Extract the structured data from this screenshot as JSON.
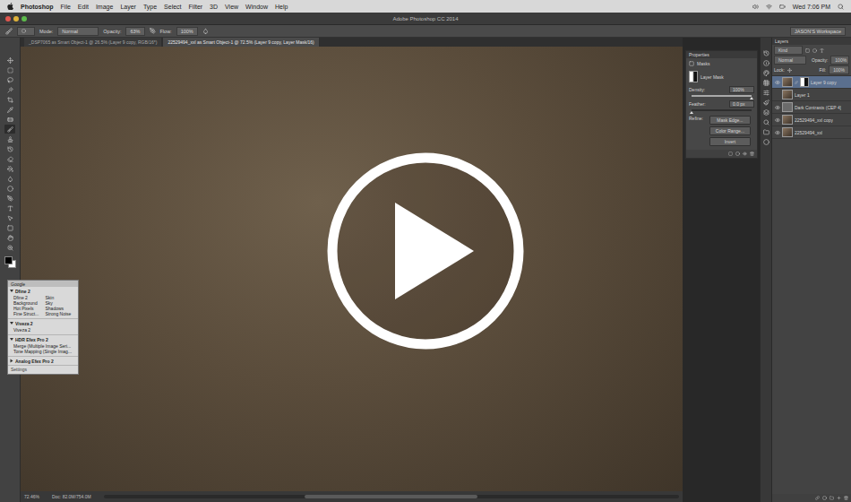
{
  "menubar": {
    "items": [
      "Photoshop",
      "File",
      "Edit",
      "Image",
      "Layer",
      "Type",
      "Select",
      "Filter",
      "3D",
      "View",
      "Window",
      "Help"
    ],
    "clock": "Wed 7:06 PM"
  },
  "window": {
    "title": "Adobe Photoshop CC 2014"
  },
  "options_bar": {
    "mode_label": "Mode:",
    "mode": "Normal",
    "opacity_label": "Opacity:",
    "opacity": "63%",
    "flow_label": "Flow:",
    "flow": "100%",
    "workspace": "JASON'S Workspace"
  },
  "document_tabs": [
    {
      "label": "_DSP7065 as Smart Object-1 @ 26.5% (Layer 9 copy, RGB/16*)",
      "selected": false
    },
    {
      "label": "22529494_xxl as Smart Object-1 @ 72.5% (Layer 9 copy, Layer Mask/16)",
      "selected": true
    }
  ],
  "tools": [
    {
      "selected": false
    },
    {
      "selected": false
    },
    {
      "selected": false
    },
    {
      "selected": false
    },
    {
      "selected": false
    },
    {
      "selected": false
    },
    {
      "selected": false
    },
    {
      "selected": true
    },
    {
      "selected": false
    },
    {
      "selected": false
    },
    {
      "selected": false
    },
    {
      "selected": false
    },
    {
      "selected": false
    },
    {
      "selected": false
    },
    {
      "selected": false
    },
    {
      "selected": false
    },
    {
      "selected": false
    },
    {
      "selected": false
    },
    {
      "selected": false
    },
    {
      "selected": false
    }
  ],
  "properties": {
    "title": "Properties",
    "section": "Masks",
    "mask_type": "Layer Mask",
    "density": {
      "label": "Density:",
      "reading": "100%",
      "level": 1
    },
    "feather": {
      "label": "Feather:",
      "reading": "0.0 px",
      "level": 0
    },
    "refine_label": "Refine:",
    "buttons": [
      "Mask Edge...",
      "Color Range...",
      "Invert"
    ]
  },
  "layers_panel": {
    "title": "Layers",
    "filter": "Kind",
    "blend_mode": "Normal",
    "opacity_label": "Opacity:",
    "opacity": "100%",
    "lock_label": "Lock:",
    "fill_label": "Fill:",
    "fill": "100%",
    "layers": [
      {
        "name": "Layer 9 copy",
        "visible": true,
        "selected": true,
        "has_mask": true
      },
      {
        "name": "Layer 1",
        "visible": false,
        "selected": false,
        "has_mask": false
      },
      {
        "name": "Dark Contrasts (CEP 4)",
        "visible": true,
        "selected": false,
        "has_mask": false
      },
      {
        "name": "22529494_xxl copy",
        "visible": true,
        "selected": false,
        "has_mask": false
      },
      {
        "name": "22529494_xxl",
        "visible": true,
        "selected": false,
        "has_mask": false
      }
    ]
  },
  "nik_panel": {
    "title": "Google",
    "groups": [
      {
        "name": "Dfine 2",
        "expanded": true,
        "kind": "grid",
        "presets": [
          "Dfine 2",
          "Skin",
          "Background",
          "Sky",
          "Hot Pixels",
          "Shadows",
          "Fine Struct...",
          "Strong Noise"
        ]
      },
      {
        "name": "Viveza 2",
        "expanded": true,
        "kind": "list",
        "presets": [
          "Viveza 2"
        ]
      },
      {
        "name": "HDR Efex Pro 2",
        "expanded": true,
        "kind": "list",
        "presets": [
          "Merge (Multiple Image Seri...",
          "Tone Mapping (Single Imag..."
        ]
      },
      {
        "name": "Analog Efex Pro 2",
        "expanded": false,
        "kind": "list",
        "presets": []
      }
    ],
    "footer": "Settings"
  },
  "status_bar": {
    "zoom": "72.46%",
    "doc": "Doc: 82.0M/754.0M"
  },
  "video": {
    "paused": true
  }
}
